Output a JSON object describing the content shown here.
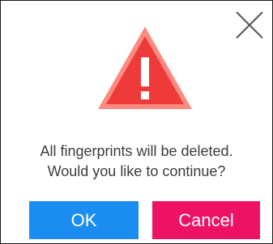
{
  "dialog": {
    "icons": {
      "close": "close-icon",
      "warning": "warning-triangle-icon"
    },
    "message_line1": "All fingerprints will be deleted.",
    "message_line2": "Would you like to continue?",
    "ok_label": "OK",
    "cancel_label": "Cancel"
  },
  "colors": {
    "warning_outer": "#ff8a80",
    "warning_inner": "#ef3a3a",
    "ok_button": "#1b8cf0",
    "cancel_button": "#ee1265",
    "text": "#3c3c3c",
    "close_icon": "#555555"
  }
}
